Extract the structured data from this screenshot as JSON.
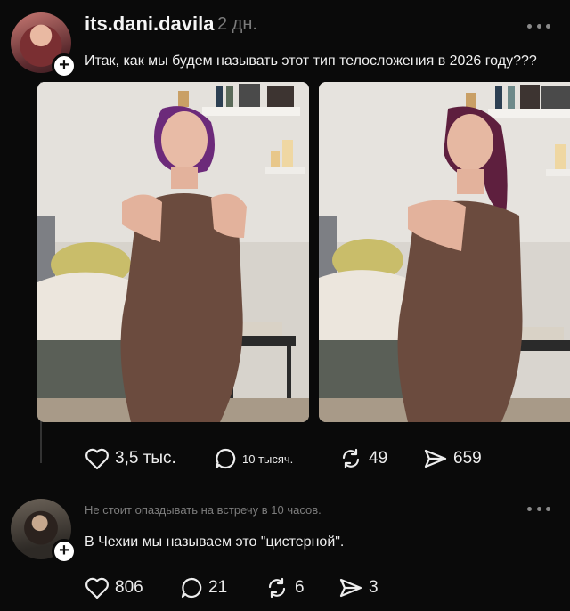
{
  "post": {
    "username": "its.dani.davila",
    "time": "2 дн.",
    "text": "Итак, как мы будем называть этот тип телосложения в 2026 году???",
    "avatar_icon": "user-avatar",
    "images": [
      {
        "desc_icon": "photo"
      },
      {
        "desc_icon": "photo"
      }
    ],
    "stats": {
      "likes": "3,5 тыс.",
      "comments": "10 тысяч.",
      "reposts": "49",
      "shares": "659"
    }
  },
  "reply": {
    "meta": "Не стоит опаздывать на встречу в 10 часов.",
    "text": "В Чехии мы называем это \"цистерной\".",
    "stats": {
      "likes": "806",
      "comments": "21",
      "reposts": "6",
      "shares": "3"
    }
  },
  "colors": {
    "background": "#0a0a0a",
    "text": "#f0f0f0",
    "muted": "#7b7b7b"
  }
}
